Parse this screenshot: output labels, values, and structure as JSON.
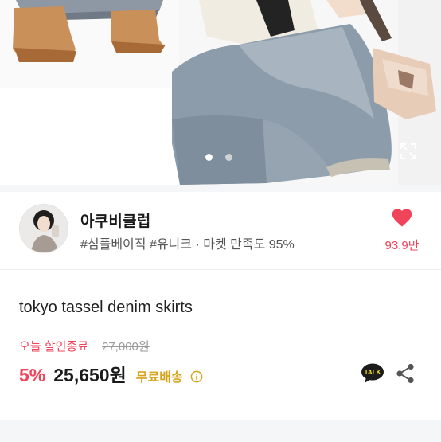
{
  "gallery": {
    "dot_count": 2,
    "active_index": 0,
    "expand_icon": "expand-icon"
  },
  "shop": {
    "name": "아쿠비클럽",
    "tags": "#심플베이직 #유니크",
    "separator": "·",
    "satisfaction_label": "마켓 만족도",
    "satisfaction_value": "95%",
    "like_icon": "heart-icon",
    "like_count": "93.9만"
  },
  "product": {
    "title": "tokyo tassel denim skirts",
    "today_discount_label": "오늘 할인종료",
    "original_price": "27,000원",
    "discount_rate": "5%",
    "sale_price": "25,650원",
    "shipping_label": "무료배송",
    "talk_label": "TALK"
  },
  "colors": {
    "accent_red": "#f0445a",
    "shipping_gold": "#d8a31b",
    "talk_yellow": "#ffe812"
  }
}
